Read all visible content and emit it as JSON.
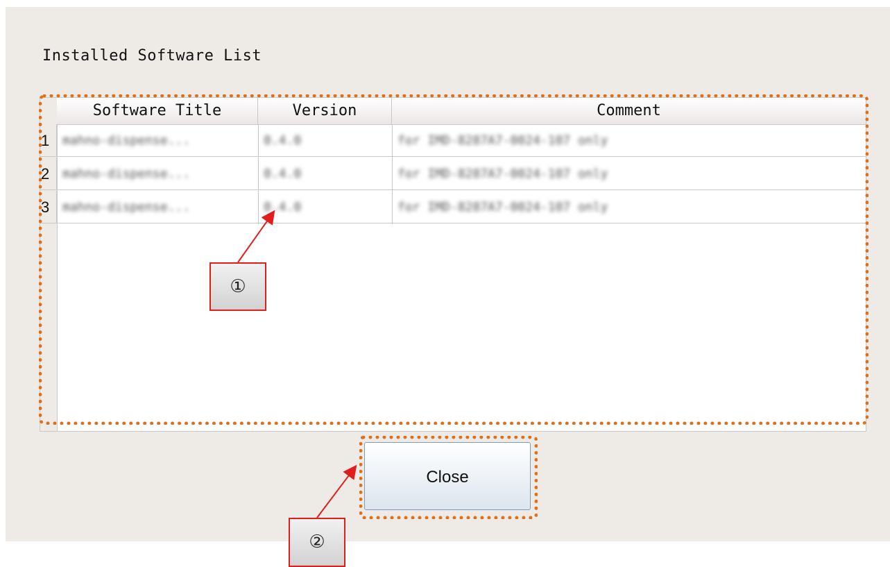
{
  "panel": {
    "title": "Installed Software List"
  },
  "table": {
    "columns": [
      "Software Title",
      "Version",
      "Comment"
    ],
    "rows": [
      {
        "num": "1",
        "title": "mahno-dispense...",
        "version": "0.4.0",
        "comment": "for IMD-8287A7-0024-107 only"
      },
      {
        "num": "2",
        "title": "mahno-dispense...",
        "version": "0.4.0",
        "comment": "for IMD-8287A7-0024-107 only"
      },
      {
        "num": "3",
        "title": "mahno-dispense...",
        "version": "0.4.0",
        "comment": "for IMD-8287A7-0024-107 only"
      }
    ]
  },
  "buttons": {
    "close_label": "Close"
  },
  "annotations": {
    "callout_1": "①",
    "callout_2": "②",
    "highlight_color": "#e06f1a",
    "arrow_color": "#e21d1d"
  }
}
